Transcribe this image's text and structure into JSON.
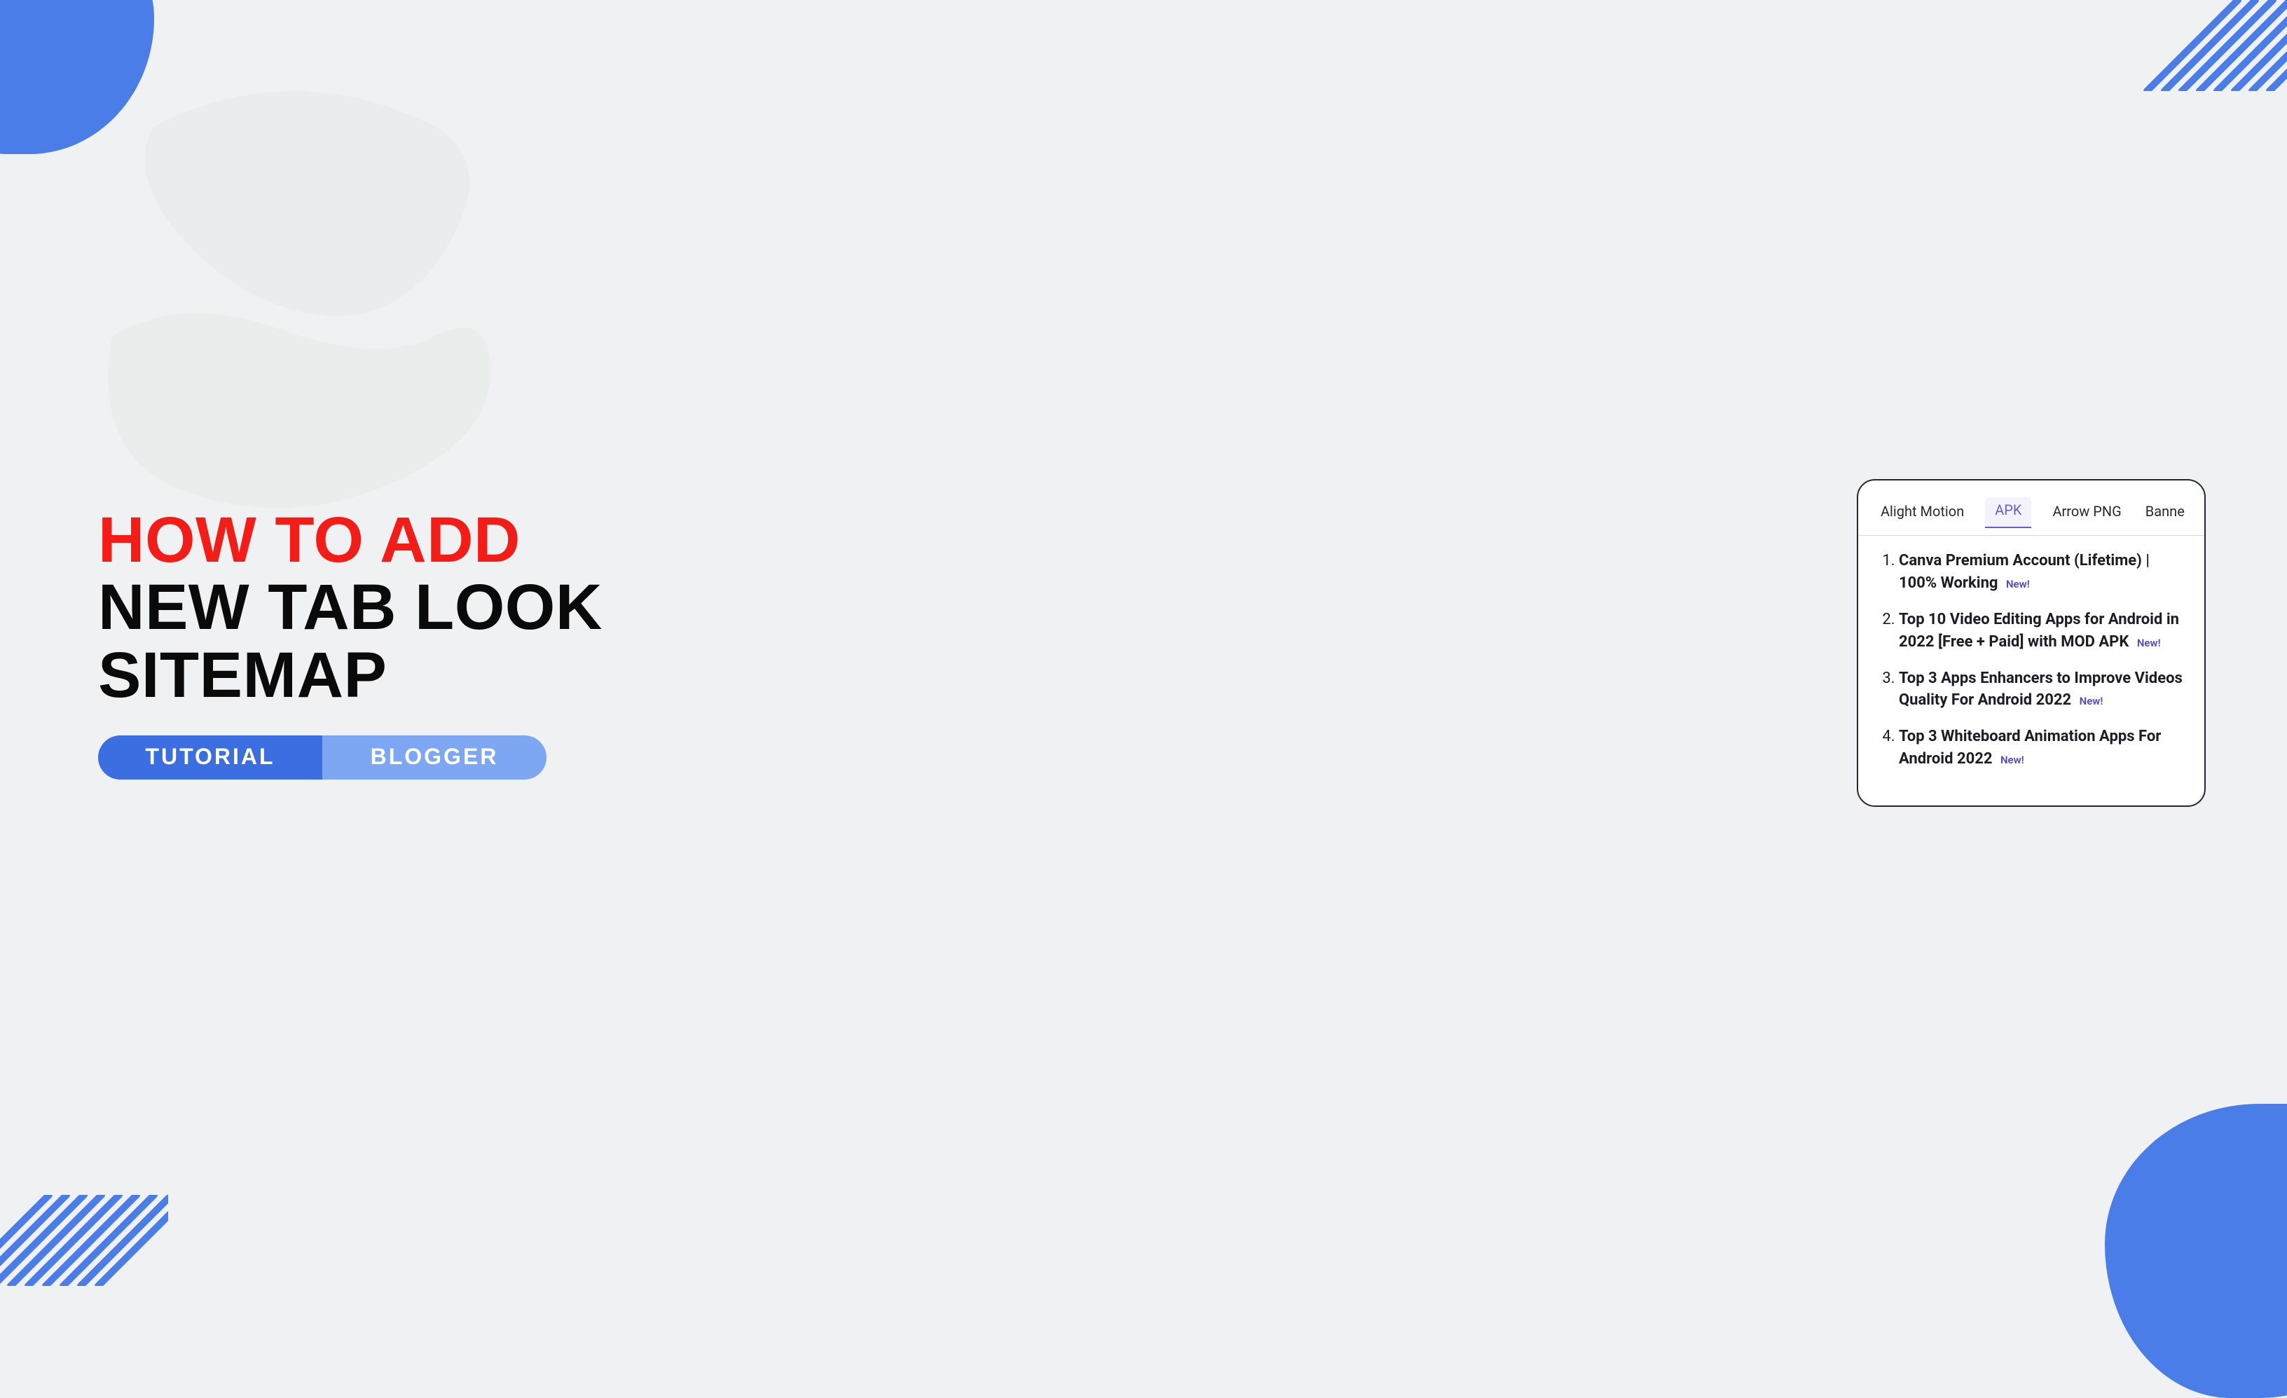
{
  "headline": {
    "line1": "HOW TO ADD",
    "line2": "NEW TAB LOOK",
    "line3": "SITEMAP"
  },
  "pills": {
    "a": "TUTORIAL",
    "b": "BLOGGER"
  },
  "widget": {
    "tabs": [
      {
        "label": "Alight Motion",
        "active": false
      },
      {
        "label": "APK",
        "active": true
      },
      {
        "label": "Arrow PNG",
        "active": false
      },
      {
        "label": "Banne",
        "active": false
      }
    ],
    "new_label": "New!",
    "posts": [
      {
        "title": "Canva Premium Account (Lifetime) | 100% Working"
      },
      {
        "title": "Top 10 Video Editing Apps for Android in 2022 [Free + Paid] with MOD APK"
      },
      {
        "title": "Top 3 Apps Enhancers to Improve Videos Quality For Android 2022"
      },
      {
        "title": "Top 3 Whiteboard Animation Apps For Android 2022"
      }
    ]
  }
}
